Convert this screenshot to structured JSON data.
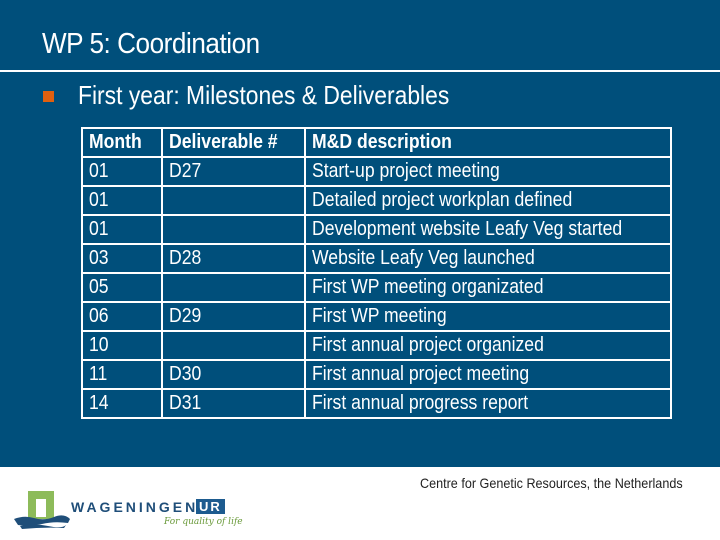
{
  "slide": {
    "title": "WP 5: Coordination",
    "bullet_text": "First year: Milestones & Deliverables",
    "accent_color": "#e0600f",
    "background_color": "#004f7b"
  },
  "table": {
    "headers": [
      "Month",
      "Deliverable #",
      "M&D description"
    ],
    "rows": [
      [
        "01",
        "D27",
        "Start-up project meeting"
      ],
      [
        "01",
        "",
        "Detailed project workplan defined"
      ],
      [
        "01",
        "",
        "Development website Leafy Veg started"
      ],
      [
        "03",
        "D28",
        "Website Leafy Veg launched"
      ],
      [
        "05",
        "",
        "First WP meeting organizated"
      ],
      [
        "06",
        "D29",
        "First WP meeting"
      ],
      [
        "10",
        "",
        "First annual project organized"
      ],
      [
        "11",
        "D30",
        "First annual project meeting"
      ],
      [
        "14",
        "D31",
        "First annual progress report"
      ]
    ]
  },
  "footer": {
    "organization": "Centre for Genetic Resources, the Netherlands",
    "logo_word": "WAGENINGEN",
    "logo_ur": "UR",
    "logo_tagline": "For quality of life"
  }
}
